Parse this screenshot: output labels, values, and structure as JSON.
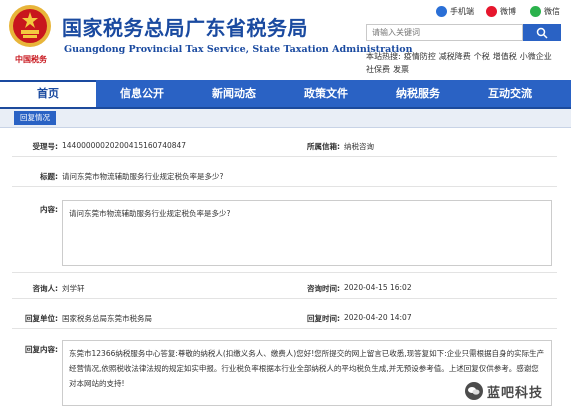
{
  "site": {
    "title_cn": "国家税务总局广东省税务局",
    "title_en": "Guangdong Provincial Tax Service, State Taxation Administration",
    "emblem_text": "中国税务"
  },
  "social": {
    "phone_label": "手机端",
    "weibo_label": "微博",
    "wechat_label": "微信"
  },
  "search": {
    "placeholder": "请输入关键词",
    "hot_label": "本站热搜:",
    "hot_keywords": [
      "疫情防控",
      "减税降费",
      "个税",
      "增值税",
      "小微企业",
      "社保费",
      "发票"
    ]
  },
  "nav": {
    "items": [
      "首页",
      "信息公开",
      "新闻动态",
      "政策文件",
      "纳税服务",
      "互动交流"
    ],
    "active_index": 0
  },
  "subtab": {
    "label": "回复情况"
  },
  "detail": {
    "accept_no_label": "受理号:",
    "accept_no": "14400000020200415160740847",
    "category_label": "所属信箱:",
    "category": "纳税咨询",
    "subject_label": "标题:",
    "subject": "请问东莞市物流辅助服务行业规定税负率是多少?",
    "content_label": "内容:",
    "content": "请问东莞市物流辅助服务行业规定税负率是多少?",
    "asker_label": "咨询人:",
    "asker": "刘学轩",
    "ask_time_label": "咨询时间:",
    "ask_time": "2020-04-15 16:02",
    "reply_unit_label": "回复单位:",
    "reply_unit": "国家税务总局东莞市税务局",
    "reply_time_label": "回复时间:",
    "reply_time": "2020-04-20 14:07",
    "reply_content_label": "回复内容:",
    "reply_content": "东莞市12366纳税服务中心答复:尊敬的纳税人(扣缴义务人、缴费人)您好!您所提交的网上留言已收悉,现答复如下:企业只需根据自身的实际生产经营情况,依照税收法律法规的规定如实申报。行业税负率根据本行业全部纳税人的平均税负生成,并无预设参考值。上述回复仅供参考。感谢您对本网站的支持!"
  },
  "watermark": {
    "text": "蓝吧科技"
  },
  "colors": {
    "brand_blue": "#1a4aa0",
    "nav_blue": "#2a62c4",
    "emblem_red": "#c8161d"
  }
}
